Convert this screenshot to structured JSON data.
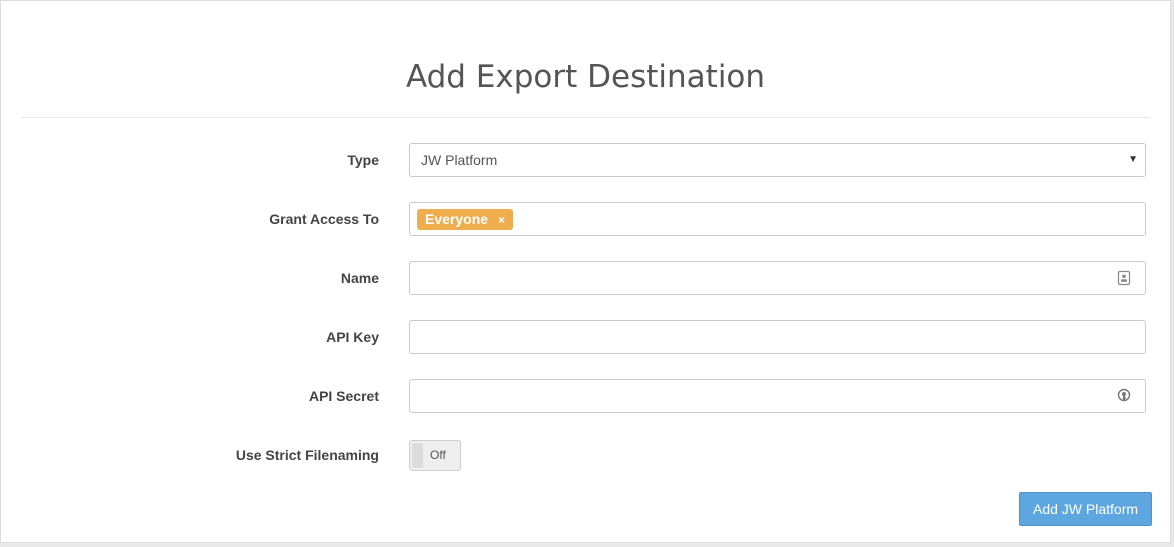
{
  "dialog": {
    "title": "Add Export Destination"
  },
  "form": {
    "type": {
      "label": "Type",
      "value": "JW Platform"
    },
    "grant_access": {
      "label": "Grant Access To",
      "tags": [
        {
          "text": "Everyone",
          "remove": "×"
        }
      ]
    },
    "name": {
      "label": "Name",
      "value": ""
    },
    "api_key": {
      "label": "API Key",
      "value": ""
    },
    "api_secret": {
      "label": "API Secret",
      "value": ""
    },
    "strict_filenaming": {
      "label": "Use Strict Filenaming",
      "state": "Off"
    }
  },
  "actions": {
    "submit_label": "Add JW Platform"
  },
  "icons": {
    "type_select": "chevron-down-icon",
    "tag_remove": "close-icon",
    "name_field": "contact-card-icon",
    "secret_field": "password-key-icon"
  },
  "colors": {
    "tag_bg": "#f0ad4e",
    "primary_button": "#5ea6df"
  }
}
